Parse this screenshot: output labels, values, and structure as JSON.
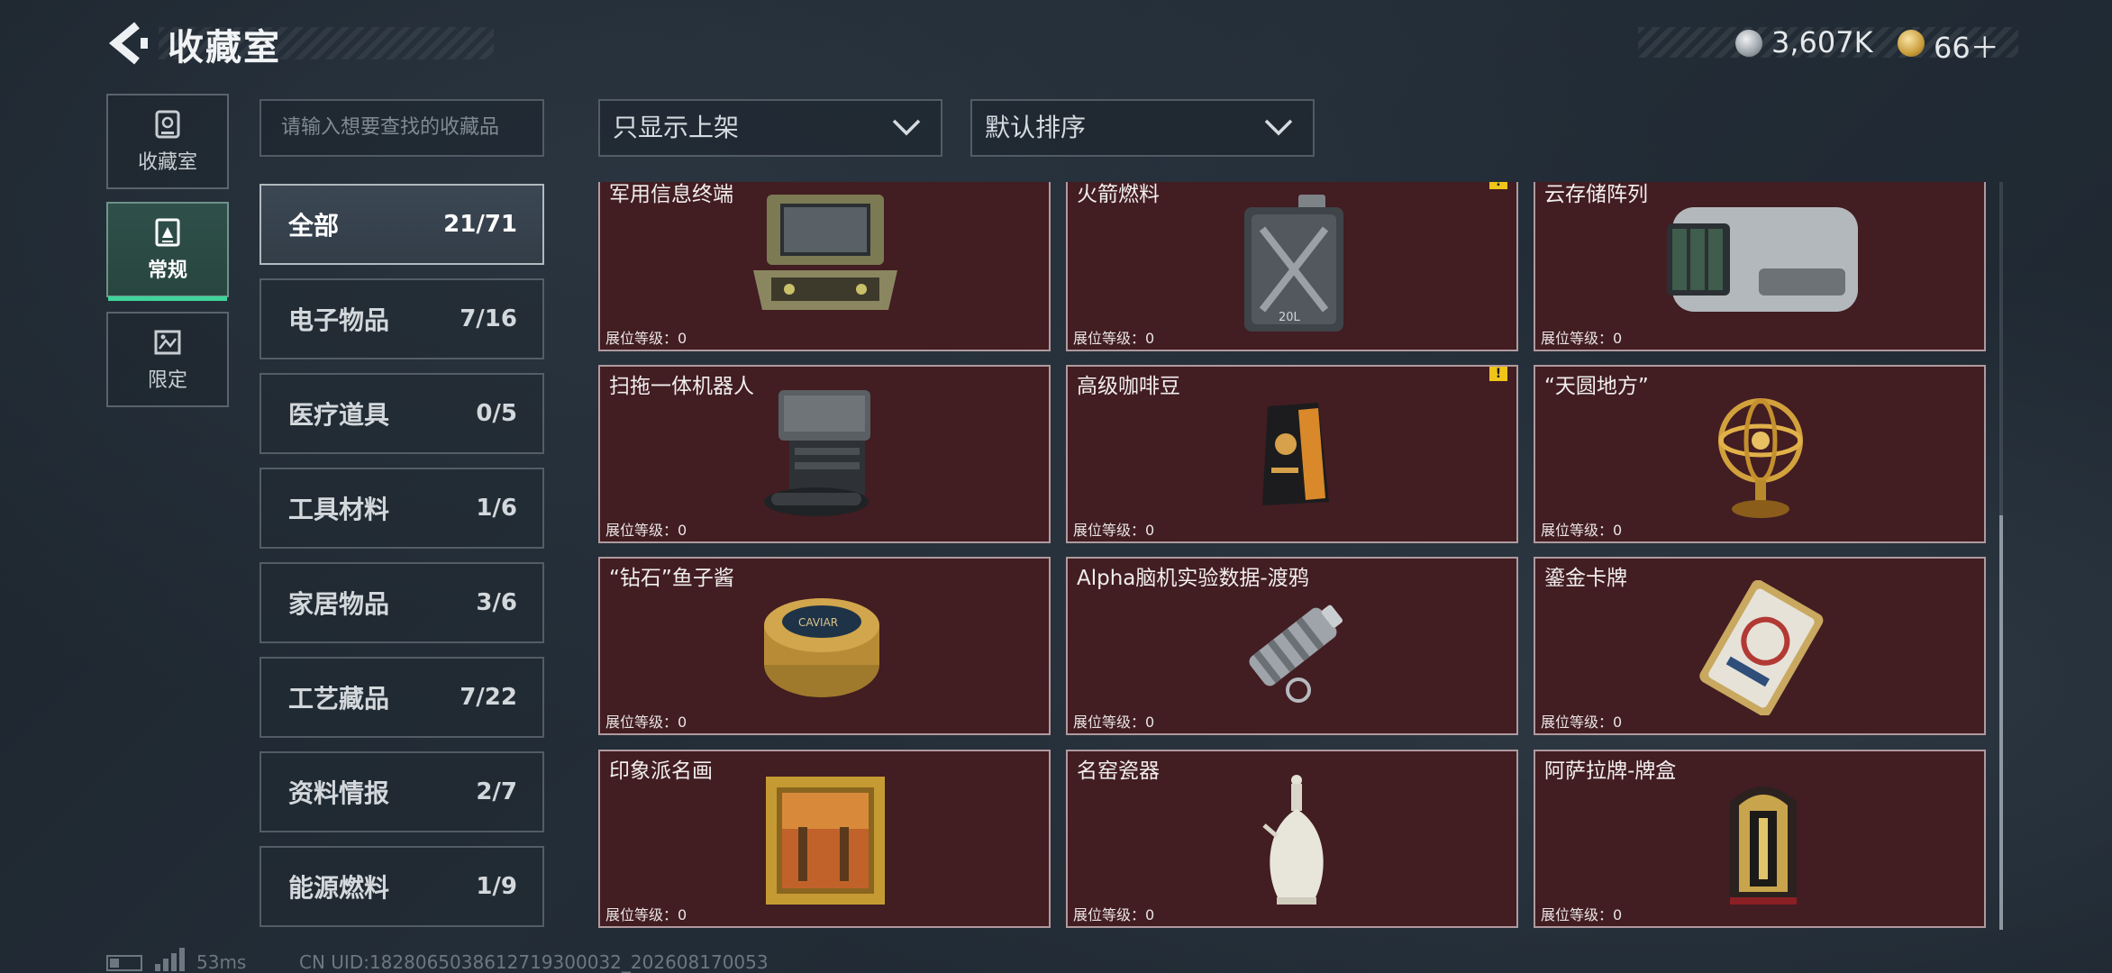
{
  "header": {
    "title": "收藏室",
    "currencies": [
      {
        "icon": "silver-coin-icon",
        "value": "3,607K"
      },
      {
        "icon": "gold-coin-icon",
        "value": "66＋"
      }
    ]
  },
  "side_tabs": [
    {
      "label": "收藏室",
      "icon": "vault-icon"
    },
    {
      "label": "常规",
      "icon": "regular-card-icon",
      "active": true
    },
    {
      "label": "限定",
      "icon": "limited-image-icon"
    }
  ],
  "search": {
    "placeholder": "请输入想要查找的收藏品"
  },
  "filter_dropdown": {
    "value": "只显示上架"
  },
  "sort_dropdown": {
    "value": "默认排序"
  },
  "categories": [
    {
      "name": "全部",
      "count": "21/71",
      "active": true
    },
    {
      "name": "电子物品",
      "count": "7/16"
    },
    {
      "name": "医疗道具",
      "count": "0/5"
    },
    {
      "name": "工具材料",
      "count": "1/6"
    },
    {
      "name": "家居物品",
      "count": "3/6"
    },
    {
      "name": "工艺藏品",
      "count": "7/22"
    },
    {
      "name": "资料情报",
      "count": "2/7"
    },
    {
      "name": "能源燃料",
      "count": "1/9"
    }
  ],
  "level_label": "展位等级：0",
  "items": [
    {
      "name": "军用信息终端",
      "icon": "military-terminal-icon",
      "warn": false
    },
    {
      "name": "火箭燃料",
      "icon": "fuel-canister-icon",
      "warn": true
    },
    {
      "name": "云存储阵列",
      "icon": "cloud-storage-icon",
      "warn": false
    },
    {
      "name": "扫拖一体机器人",
      "icon": "mop-robot-icon",
      "warn": false
    },
    {
      "name": "高级咖啡豆",
      "icon": "coffee-bag-icon",
      "warn": true
    },
    {
      "name": "“天圆地方”",
      "icon": "armillary-sphere-icon",
      "warn": false
    },
    {
      "name": "“钻石”鱼子酱",
      "icon": "caviar-tin-icon",
      "warn": false
    },
    {
      "name": "Alpha脑机实验数据-渡鸦",
      "icon": "data-cylinder-icon",
      "warn": false
    },
    {
      "name": "鎏金卡牌",
      "icon": "gilded-card-icon",
      "warn": false
    },
    {
      "name": "印象派名画",
      "icon": "framed-painting-icon",
      "warn": false
    },
    {
      "name": "名窑瓷器",
      "icon": "porcelain-vase-icon",
      "warn": false
    },
    {
      "name": "阿萨拉牌-牌盒",
      "icon": "card-box-icon",
      "warn": false
    }
  ],
  "warn_mark": "!",
  "footer": {
    "ping": "53ms",
    "uid": "CN UID:1828065038612719300032_202608170053"
  }
}
